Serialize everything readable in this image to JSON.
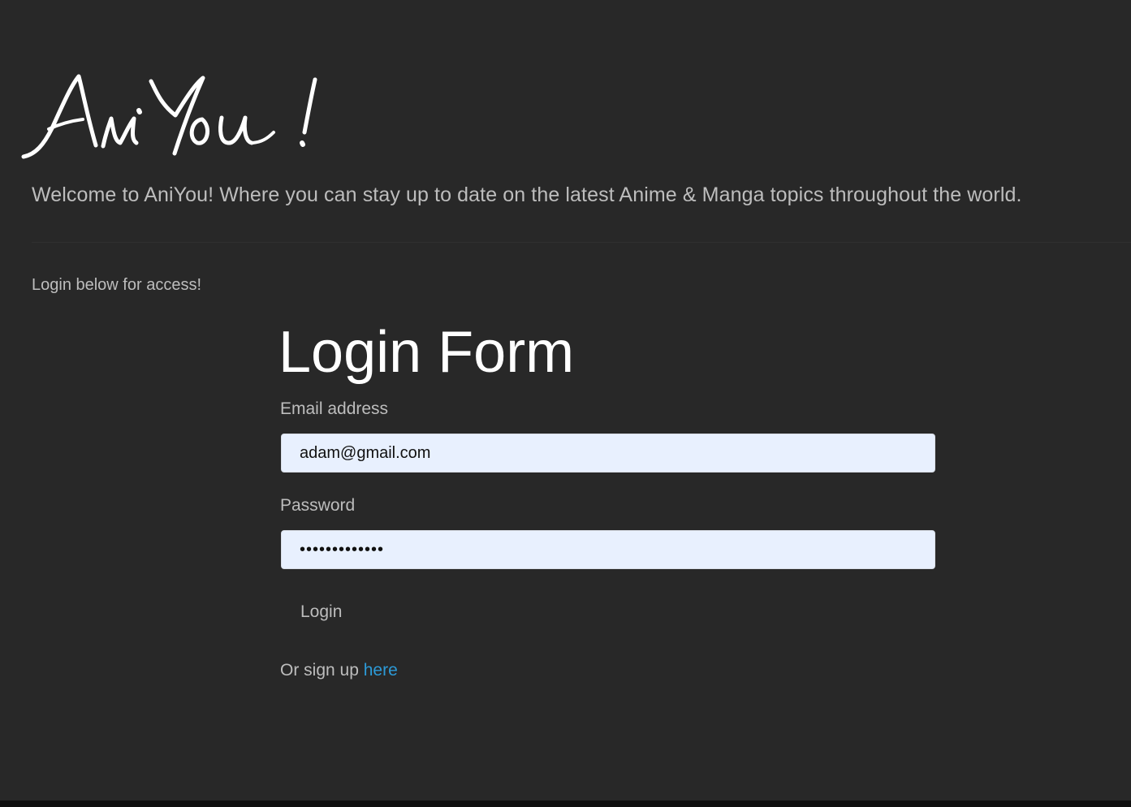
{
  "header": {
    "logo_text": "AniYou!",
    "tagline": "Welcome to AniYou! Where you can stay up to date on the latest Anime & Manga topics throughout the world."
  },
  "intro": {
    "login_note": "Login below for access!"
  },
  "form": {
    "title": "Login Form",
    "email_label": "Email address",
    "email_value": "adam@gmail.com",
    "password_label": "Password",
    "password_value": "•••••••••••••",
    "login_button": "Login",
    "signup_prefix": "Or sign up",
    "signup_link": "here"
  },
  "colors": {
    "background": "#282828",
    "text": "#bdbdbd",
    "title": "#ffffff",
    "input_background": "#e8f0fe",
    "link": "#2c9ad7"
  }
}
